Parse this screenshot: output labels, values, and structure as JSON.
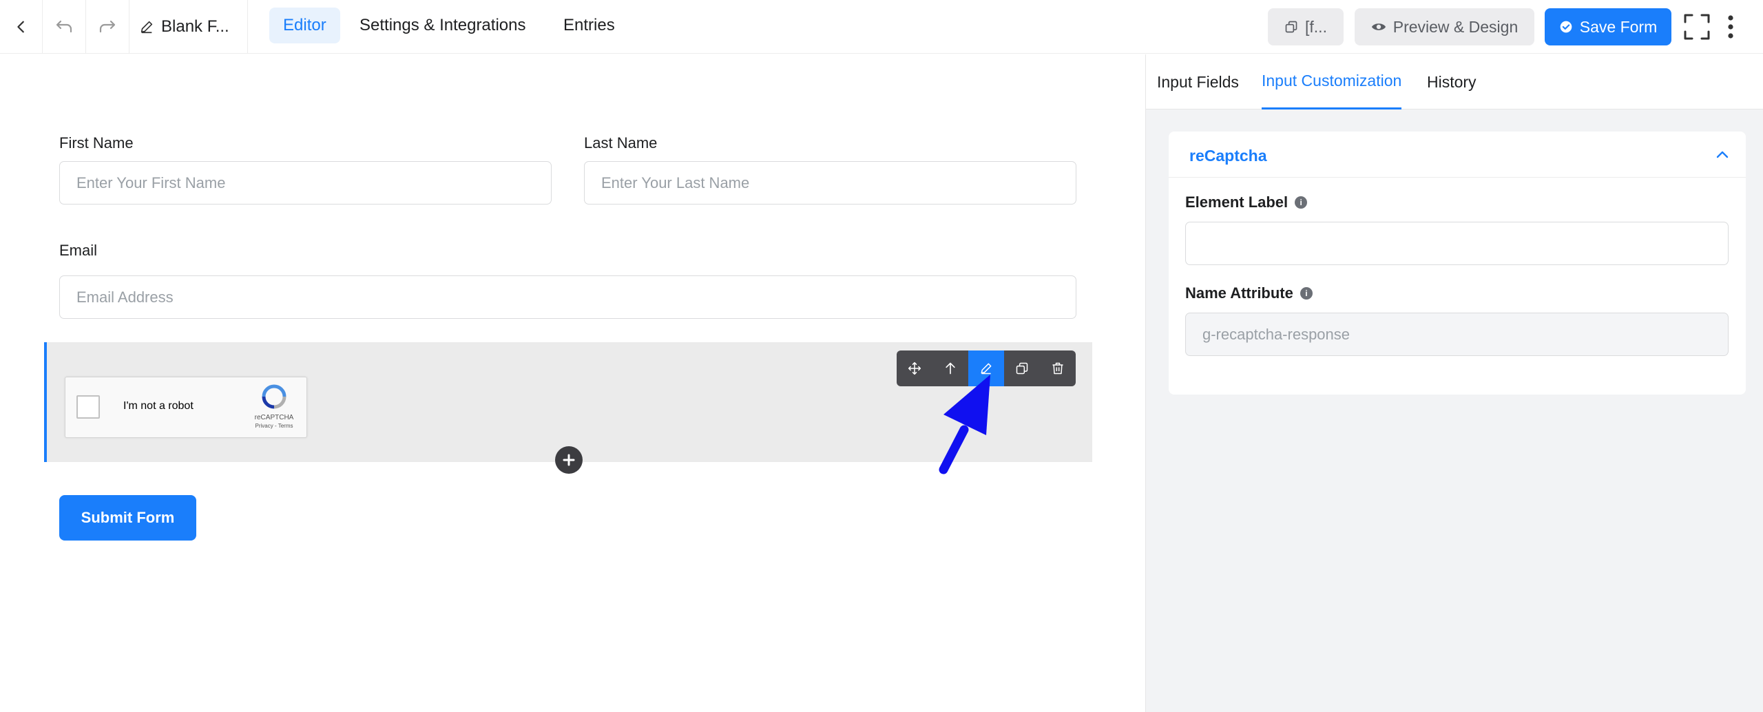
{
  "header": {
    "form_title": "Blank F...",
    "tabs": [
      {
        "label": "Editor",
        "active": true
      },
      {
        "label": "Settings & Integrations",
        "active": false
      },
      {
        "label": "Entries",
        "active": false
      }
    ],
    "shortcode_label": "[f...",
    "preview_label": "Preview & Design",
    "save_label": "Save Form"
  },
  "form": {
    "first_name": {
      "label": "First Name",
      "placeholder": "Enter Your First Name"
    },
    "last_name": {
      "label": "Last Name",
      "placeholder": "Enter Your Last Name"
    },
    "email": {
      "label": "Email",
      "placeholder": "Email Address"
    },
    "captcha": {
      "text": "I'm not a robot",
      "brand": "reCAPTCHA",
      "links": "Privacy - Terms"
    },
    "submit_label": "Submit Form"
  },
  "sidebar": {
    "tabs": [
      {
        "label": "Input Fields",
        "active": false
      },
      {
        "label": "Input Customization",
        "active": true
      },
      {
        "label": "History",
        "active": false
      }
    ],
    "card": {
      "title": "reCaptcha",
      "element_label": {
        "label": "Element Label",
        "value": ""
      },
      "name_attribute": {
        "label": "Name Attribute",
        "value": "g-recaptcha-response"
      }
    }
  },
  "colors": {
    "accent": "#1a7efb",
    "arrow": "#1010f0",
    "toolbar": "#4a4a4e"
  }
}
